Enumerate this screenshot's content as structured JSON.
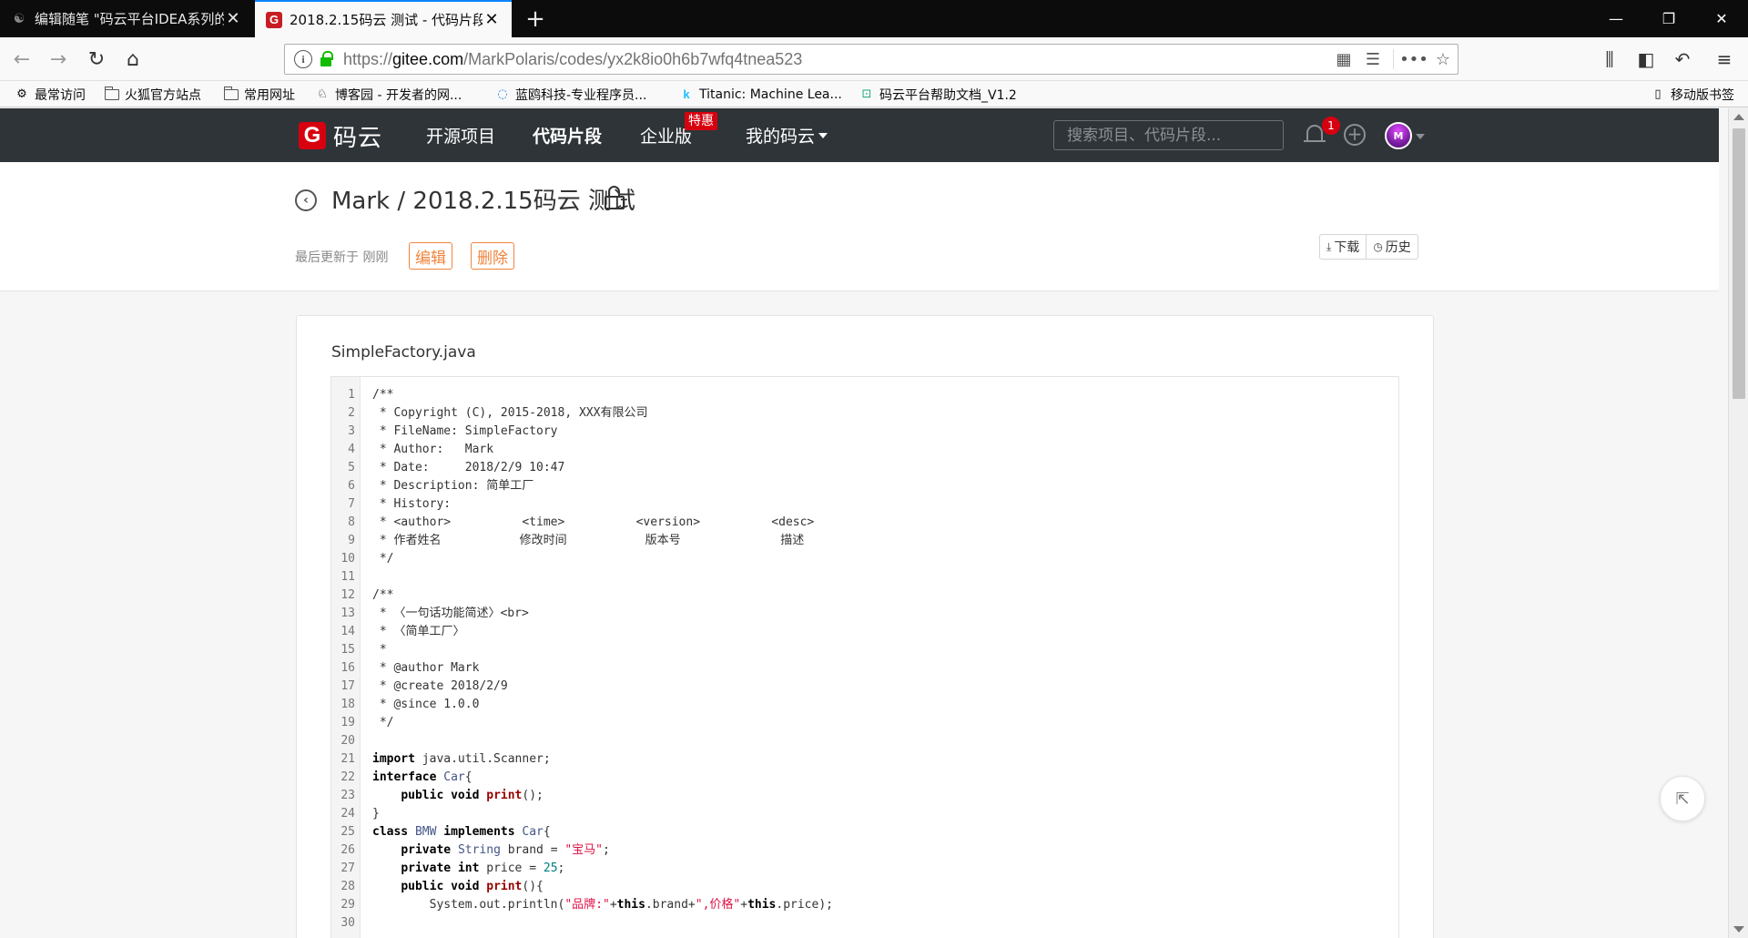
{
  "browser": {
    "tabs": [
      {
        "title": "编辑随笔 \"码云平台IDEA系列的",
        "active": false
      },
      {
        "title": "2018.2.15码云 测试 - 代码片段",
        "active": true
      }
    ],
    "url": {
      "scheme": "https://",
      "host": "gitee.com",
      "path": "/MarkPolaris/codes/yx2k8io0h6b7wfq4tnea523"
    },
    "bookmarks": [
      {
        "label": "最常访问",
        "icon": "gear-icon"
      },
      {
        "label": "火狐官方站点",
        "icon": "folder-icon"
      },
      {
        "label": "常用网址",
        "icon": "folder-icon"
      },
      {
        "label": "博客园 - 开发者的网...",
        "icon": "cnblogs-icon"
      },
      {
        "label": "蓝鸥科技-专业程序员...",
        "icon": "loop-icon"
      },
      {
        "label": "Titanic: Machine Lea...",
        "icon": "kaggle-icon"
      },
      {
        "label": "码云平台帮助文档_V1.2",
        "icon": "doc-icon"
      }
    ],
    "mobile_bookmarks": "移动版书签"
  },
  "site": {
    "logo_letter": "G",
    "logo_text": "码云",
    "nav": [
      {
        "label": "开源项目",
        "active": false
      },
      {
        "label": "代码片段",
        "active": true
      },
      {
        "label": "企业版",
        "active": false
      },
      {
        "label": "我的码云",
        "active": false
      }
    ],
    "enterprise_badge": "特惠",
    "search_placeholder": "搜索项目、代码片段...",
    "notification_count": "1",
    "avatar_letter": "M"
  },
  "snippet": {
    "title": "Mark / 2018.2.15码云 测试",
    "updated": "最后更新于 刚刚",
    "edit_label": "编辑",
    "delete_label": "删除",
    "download_label": "下载",
    "history_label": "历史",
    "filename": "SimpleFactory.java"
  },
  "code_lines": [
    "/**",
    " * Copyright (C), 2015-2018, XXX有限公司",
    " * FileName: SimpleFactory",
    " * Author:   Mark",
    " * Date:     2018/2/9 10:47",
    " * Description: 简单工厂",
    " * History:",
    " * <author>          <time>          <version>          <desc>",
    " * 作者姓名           修改时间           版本号              描述",
    " */",
    "",
    "/**",
    " * 〈一句话功能简述〉<br>",
    " * 〈简单工厂〉",
    " *",
    " * @author Mark",
    " * @create 2018/2/9",
    " * @since 1.0.0",
    " */",
    "",
    "import java.util.Scanner;",
    "interface Car{",
    "    public void print();",
    "}",
    "class BMW implements Car{",
    "    private String brand = \"宝马\";",
    "    private int price = 25;",
    "    public void print(){",
    "        System.out.println(\"品牌:\"+this.brand+\",价格\"+this.price);",
    ""
  ]
}
